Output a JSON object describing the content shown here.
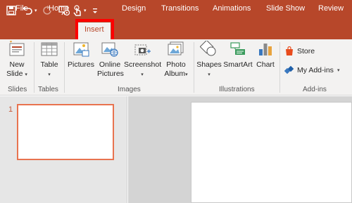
{
  "quick_access": {
    "icons": [
      "save-icon",
      "undo-icon",
      "redo-icon",
      "present-from-beginning-icon",
      "touch-mode-icon",
      "customize-qat-icon"
    ],
    "dropdown_glyph": "▾"
  },
  "tabs": [
    {
      "label": "File",
      "active": false
    },
    {
      "label": "Home",
      "active": false
    },
    {
      "label": "Insert",
      "active": true
    },
    {
      "label": "Design",
      "active": false
    },
    {
      "label": "Transitions",
      "active": false
    },
    {
      "label": "Animations",
      "active": false
    },
    {
      "label": "Slide Show",
      "active": false
    },
    {
      "label": "Review",
      "active": false
    }
  ],
  "ribbon": {
    "slides": {
      "label": "Slides",
      "new_slide": [
        "New",
        "Slide"
      ]
    },
    "tables": {
      "label": "Tables",
      "table": "Table"
    },
    "images": {
      "label": "Images",
      "pictures": "Pictures",
      "online_pictures": [
        "Online",
        "Pictures"
      ],
      "screenshot": "Screenshot",
      "photo_album": [
        "Photo",
        "Album"
      ]
    },
    "illustrations": {
      "label": "Illustrations",
      "shapes": "Shapes",
      "smartart": "SmartArt",
      "chart": "Chart"
    },
    "addins": {
      "label": "Add-ins",
      "store": "Store",
      "my_addins": "My Add-ins"
    }
  },
  "thumbnails": [
    {
      "number": "1"
    }
  ],
  "colors": {
    "titlebar": "#b7472a",
    "accent": "#b7472a",
    "highlight_box": "#ff0000",
    "thumbnail_border": "#e8734f"
  }
}
